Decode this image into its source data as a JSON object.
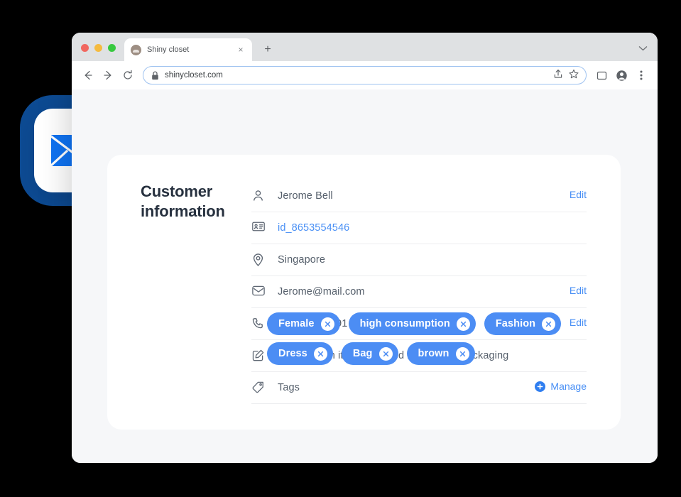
{
  "browser": {
    "traffic_lights": [
      "close",
      "minimize",
      "maximize"
    ],
    "tab": {
      "title": "Shiny closet",
      "favicon": "site-favicon",
      "close_label": "×"
    },
    "new_tab_label": "+",
    "toolbar": {
      "back": "back-arrow",
      "forward": "forward-arrow",
      "reload": "reload-arrow",
      "url": "shinycloset.com",
      "lock": "lock-icon",
      "share": "share-icon",
      "bookmark": "star-icon",
      "sidepanel": "panel-icon",
      "profile": "profile-avatar-icon",
      "menu": "three-dot-menu-icon"
    },
    "tabstrip_chevron": "chevron-down-icon"
  },
  "badge": {
    "icon": "envelope-icon",
    "icon_color": "#0f73f2",
    "blob_color": "#0d4b93"
  },
  "panel": {
    "title": "Customer information",
    "rows": [
      {
        "icon": "person-icon",
        "value": "Jerome Bell",
        "action": "Edit",
        "link": false
      },
      {
        "icon": "id-card-icon",
        "value": "id_8653554546",
        "action": "",
        "link": true
      },
      {
        "icon": "location-icon",
        "value": "Singapore",
        "action": "",
        "link": false
      },
      {
        "icon": "envelope-icon",
        "value": "Jerome@mail.com",
        "action": "Edit",
        "link": false
      },
      {
        "icon": "phone-icon",
        "value": "+65 8628 8791",
        "action": "Edit",
        "link": false
      },
      {
        "icon": "note-edit-icon",
        "value": "Returned an item damaged because of packaging",
        "action": "",
        "link": false
      }
    ],
    "tags_row": {
      "icon": "tag-icon",
      "label": "Tags",
      "manage_label": "Manage",
      "manage_icon": "plus-circle-icon"
    },
    "tags": [
      {
        "label": "Female",
        "remove": "×"
      },
      {
        "label": "high consumption",
        "remove": "×"
      },
      {
        "label": "Fashion",
        "remove": "×"
      },
      {
        "label": "Dress",
        "remove": "×"
      },
      {
        "label": "Bag",
        "remove": "×"
      },
      {
        "label": "brown",
        "remove": "×"
      }
    ]
  },
  "colors": {
    "accent_blue": "#4a90f5",
    "tag_blue": "#4c8df4",
    "navy": "#0d4b93",
    "text_dark": "#27313f",
    "text_body": "#555f6b",
    "page_bg": "#f6f7f9"
  }
}
